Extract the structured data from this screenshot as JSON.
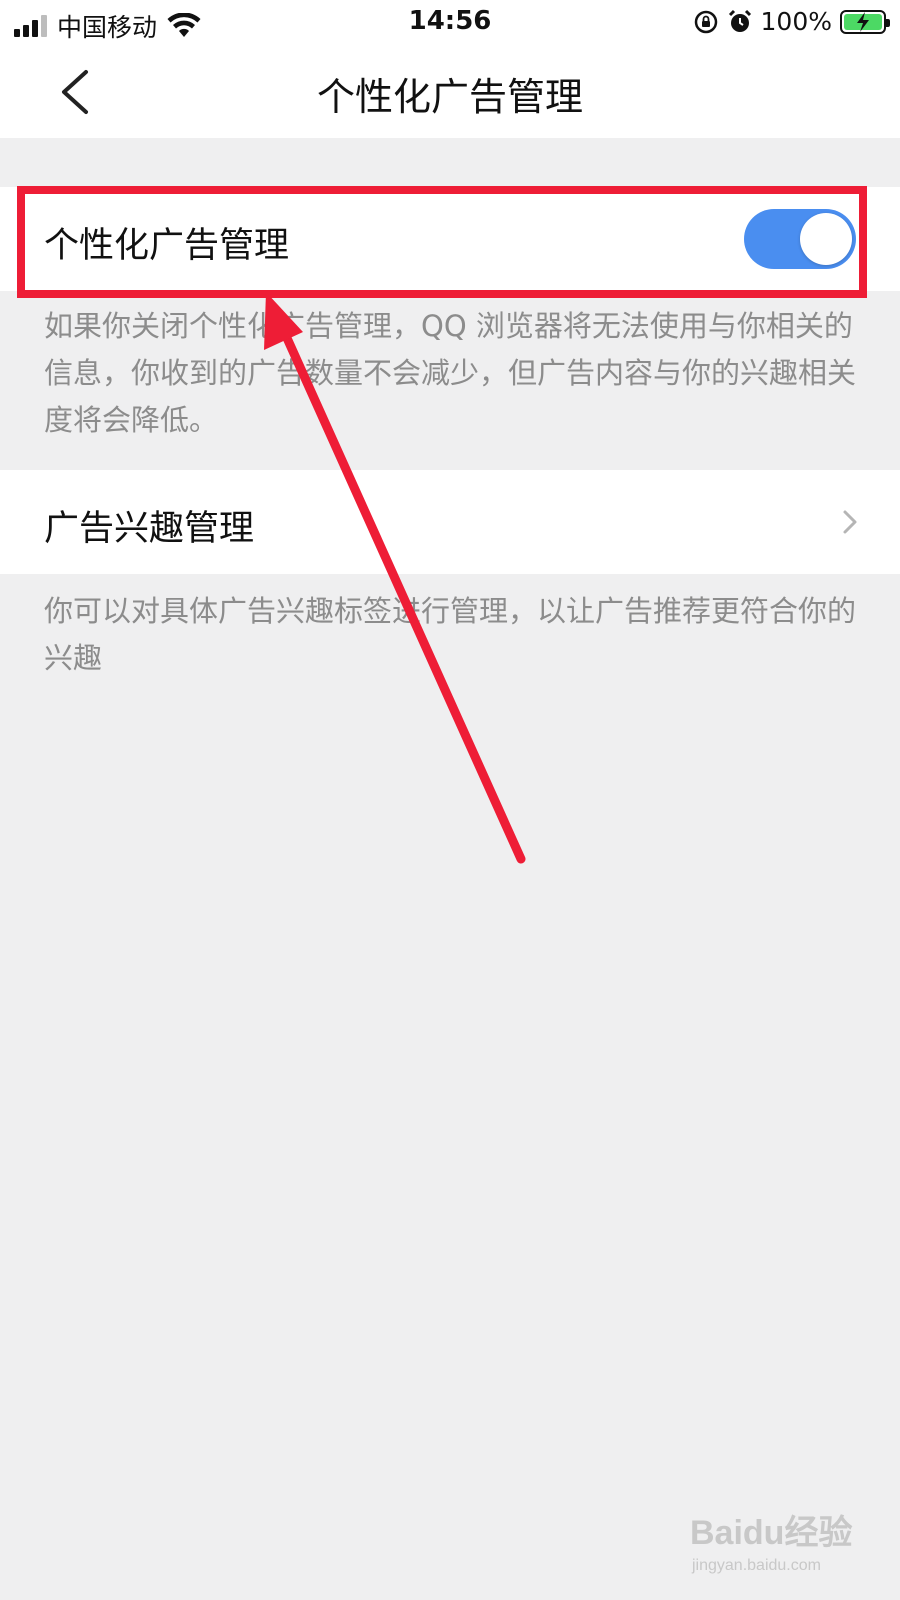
{
  "status_bar": {
    "carrier": "中国移动",
    "time": "14:56",
    "battery_percent": "100%"
  },
  "nav": {
    "title": "个性化广告管理"
  },
  "settings": {
    "personalized_ads": {
      "label": "个性化广告管理",
      "enabled": true,
      "description": "如果你关闭个性化广告管理，QQ 浏览器将无法使用与你相关的信息，你收到的广告数量不会减少，但广告内容与你的兴趣相关度将会降低。"
    },
    "ad_interests": {
      "label": "广告兴趣管理",
      "description": "你可以对具体广告兴趣标签进行管理，以让广告推荐更符合你的兴趣"
    }
  },
  "annotation": {
    "box_color": "#ee1d36",
    "arrow_color": "#ee1d36"
  },
  "watermark": {
    "brand": "Baidu经验",
    "url": "jingyan.baidu.com"
  },
  "colors": {
    "toggle_on": "#4a8ef0",
    "background": "#efeff0"
  }
}
